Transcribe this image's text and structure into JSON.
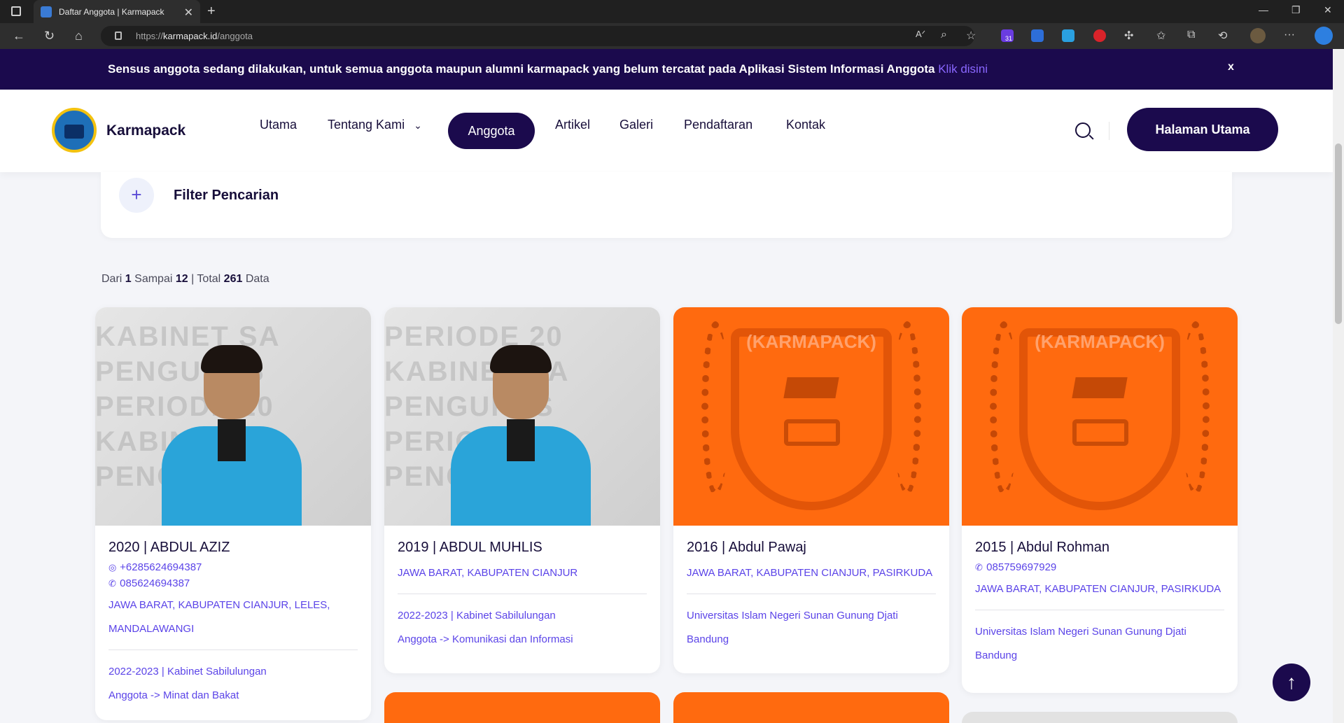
{
  "browser": {
    "tab_title": "Daftar Anggota | Karmapack",
    "url_scheme": "https://",
    "url_host": "karmapack.id",
    "url_path": "/anggota",
    "ext_badge": "31"
  },
  "notice": {
    "message": "Sensus anggota sedang dilakukan, untuk semua anggota maupun alumni karmapack yang belum tercatat pada Aplikasi Sistem Informasi Anggota",
    "link": "Klik disini",
    "close": "x"
  },
  "header": {
    "brand": "Karmapack",
    "nav": {
      "utama": "Utama",
      "tentang": "Tentang Kami",
      "anggota": "Anggota",
      "artikel": "Artikel",
      "galeri": "Galeri",
      "pendaftaran": "Pendaftaran",
      "kontak": "Kontak"
    },
    "cta": "Halaman Utama"
  },
  "filter": {
    "label": "Filter Pencarian",
    "icon": "+"
  },
  "stats": {
    "from_label": "Dari",
    "from": "1",
    "to_label": "Sampai",
    "to": "12",
    "total_label": "| Total",
    "total": "261",
    "data_label": "Data"
  },
  "members": [
    {
      "name": "2020 | ABDUL AZIZ",
      "whatsapp": "+6285624694387",
      "phone": "085624694387",
      "address_1": "JAWA BARAT, KABUPATEN CIANJUR, LELES,",
      "address_2": "MANDALAWANGI",
      "info_1": "2022-2023 | Kabinet Sabilulungan",
      "info_2": "Anggota -> Minat dan Bakat",
      "photo": "person"
    },
    {
      "name": "2019 | ABDUL MUHLIS",
      "address_1": "JAWA BARAT, KABUPATEN CIANJUR",
      "info_1": "2022-2023 | Kabinet Sabilulungan",
      "info_2": "Anggota -> Komunikasi dan Informasi",
      "photo": "person"
    },
    {
      "name": "2016 | Abdul Pawaj",
      "address_1": "JAWA BARAT, KABUPATEN CIANJUR, PASIRKUDA",
      "info_1": "Universitas Islam Negeri Sunan Gunung Djati",
      "info_2": "Bandung",
      "photo": "emblem"
    },
    {
      "name": "2015 | Abdul Rohman",
      "phone": "085759697929",
      "address_1": "JAWA BARAT, KABUPATEN CIANJUR, PASIRKUDA",
      "info_1": "Universitas Islam Negeri Sunan Gunung Djati",
      "info_2": "Bandung",
      "photo": "emblem"
    }
  ],
  "emblem_title": "(KARMAPACK)",
  "watermark": {
    "line_1": "PENGURUS",
    "line_2": "PERIODE 20",
    "line_3": "KABINET SA"
  },
  "colors": {
    "navy": "#1b0a4d",
    "accent": "#5b44e8",
    "orange": "#ff6a0f"
  }
}
